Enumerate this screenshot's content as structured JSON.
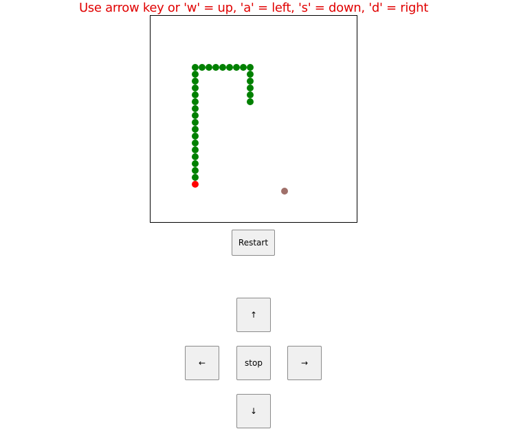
{
  "instructions": "Use arrow key or 'w' = up, 'a' = left, 's' = down, 'd' = right",
  "controls": {
    "restart_label": "Restart",
    "up_label": "↑",
    "left_label": "←",
    "stop_label": "stop",
    "right_label": "→",
    "down_label": "↓"
  },
  "colors": {
    "instructions": "#e00000",
    "snake_body": "#008000",
    "snake_head": "#ff0000",
    "food": "#a0706a"
  },
  "game": {
    "grid_cells": 30,
    "snake_body": [
      [
        6,
        8
      ],
      [
        6,
        9
      ],
      [
        6,
        10
      ],
      [
        6,
        11
      ],
      [
        6,
        12
      ],
      [
        6,
        13
      ],
      [
        6,
        14
      ],
      [
        6,
        15
      ],
      [
        6,
        16
      ],
      [
        6,
        17
      ],
      [
        6,
        18
      ],
      [
        6,
        19
      ],
      [
        6,
        20
      ],
      [
        6,
        21
      ],
      [
        6,
        22
      ],
      [
        6,
        23
      ],
      [
        6,
        7
      ],
      [
        7,
        7
      ],
      [
        8,
        7
      ],
      [
        9,
        7
      ],
      [
        10,
        7
      ],
      [
        11,
        7
      ],
      [
        12,
        7
      ],
      [
        13,
        7
      ],
      [
        14,
        7
      ],
      [
        14,
        8
      ],
      [
        14,
        9
      ],
      [
        14,
        10
      ],
      [
        14,
        11
      ],
      [
        14,
        12
      ]
    ],
    "snake_head": [
      6,
      24
    ],
    "food": [
      19,
      25
    ]
  }
}
